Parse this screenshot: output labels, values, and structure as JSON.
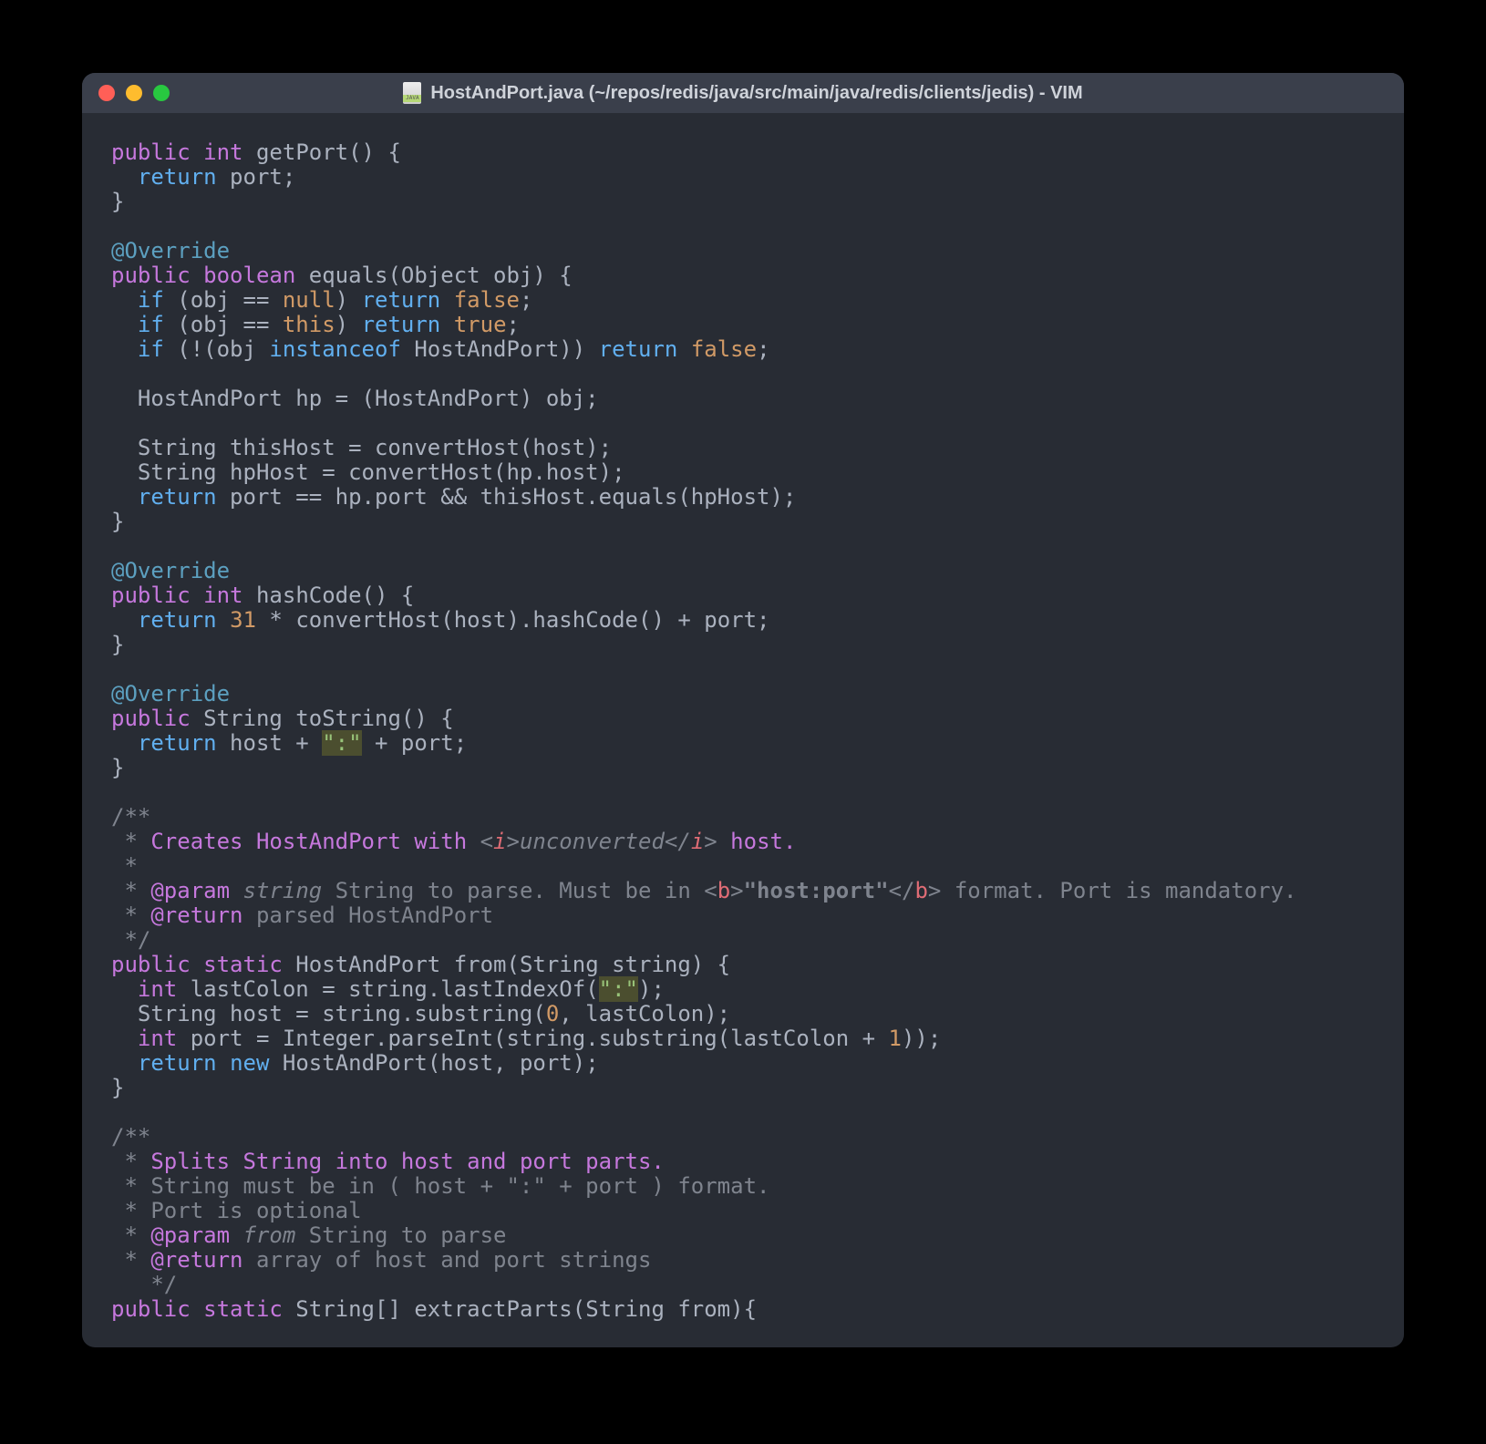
{
  "window": {
    "title": "HostAndPort.java (~/repos/redis/java/src/main/java/redis/clients/jedis) - VIM",
    "file_icon": "java-file-icon"
  },
  "code": {
    "l01_public": "public",
    "l01_int": "int",
    "l01_getport": " getPort() {",
    "l02_return": "return",
    "l02_rest": " port;",
    "l03": "}",
    "l05_ann": "@Override",
    "l06_public": "public",
    "l06_boolean": "boolean",
    "l06_rest": " equals(Object obj) {",
    "l07_if": "if",
    "l07_a": " (obj == ",
    "l07_null": "null",
    "l07_b": ") ",
    "l07_return": "return",
    "l07_false": "false",
    "l07_semi": ";",
    "l08_if": "if",
    "l08_a": " (obj == ",
    "l08_this": "this",
    "l08_b": ") ",
    "l08_return": "return",
    "l08_true": "true",
    "l08_semi": ";",
    "l09_if": "if",
    "l09_a": " (!(obj ",
    "l09_inst": "instanceof",
    "l09_b": " HostAndPort)) ",
    "l09_return": "return",
    "l09_false": "false",
    "l09_semi": ";",
    "l11": "  HostAndPort hp = (HostAndPort) obj;",
    "l13": "  String thisHost = convertHost(host);",
    "l14": "  String hpHost = convertHost(hp.host);",
    "l15_return": "return",
    "l15_rest": " port == hp.port && thisHost.equals(hpHost);",
    "l16": "}",
    "l18_ann": "@Override",
    "l19_public": "public",
    "l19_int": "int",
    "l19_rest": " hashCode() {",
    "l20_return": "return",
    "l20_num": "31",
    "l20_rest": " * convertHost(host).hashCode() + port;",
    "l21": "}",
    "l23_ann": "@Override",
    "l24_public": "public",
    "l24_rest": " String toString() {",
    "l25_return": "return",
    "l25_a": " host + ",
    "l25_str": "\":\"",
    "l25_b": " + port;",
    "l26": "}",
    "l28": "/**",
    "l29_a": " * ",
    "l29_doc": "Creates HostAndPort with ",
    "l29_lt": "<",
    "l29_i": "i",
    "l29_gt": ">",
    "l29_ital": "unconverted",
    "l29_lt2": "</",
    "l29_i2": "i",
    "l29_gt2": ">",
    "l29_doc2": " host.",
    "l30": " *",
    "l31_a": " * ",
    "l31_param": "@param",
    "l31_name": "string",
    "l31_txt": " String to parse. Must be in ",
    "l31_lt": "<",
    "l31_b": "b",
    "l31_gt": ">",
    "l31_bold": "\"host:port\"",
    "l31_lt2": "</",
    "l31_b2": "b",
    "l31_gt2": ">",
    "l31_txt2": " format. Port is mandatory.",
    "l32_a": " * ",
    "l32_return": "@return",
    "l32_txt": " parsed HostAndPort",
    "l33": " */",
    "l34_public": "public",
    "l34_static": "static",
    "l34_rest": " HostAndPort from(String string) {",
    "l35_int": "int",
    "l35_a": " lastColon = string.lastIndexOf(",
    "l35_str": "\":\"",
    "l35_b": ");",
    "l36_a": "  String host = string.substring(",
    "l36_zero": "0",
    "l36_b": ", lastColon);",
    "l37_int": "int",
    "l37_a": " port = Integer.parseInt(string.substring(lastColon + ",
    "l37_one": "1",
    "l37_b": "));",
    "l38_return": "return",
    "l38_new": "new",
    "l38_rest": " HostAndPort(host, port);",
    "l39": "}",
    "l41": "/**",
    "l42_a": " * ",
    "l42_doc": "Splits String into host and port parts.",
    "l43": " * String must be in ( host + \":\" + port ) format.",
    "l44": " * Port is optional",
    "l45_a": " * ",
    "l45_param": "@param",
    "l45_name": "from",
    "l45_txt": " String to parse",
    "l46_a": " * ",
    "l46_return": "@return",
    "l46_txt": " array of host and port strings",
    "l47": "   */",
    "l48_public": "public",
    "l48_static": "static",
    "l48_rest": " String[] extractParts(String from){"
  }
}
